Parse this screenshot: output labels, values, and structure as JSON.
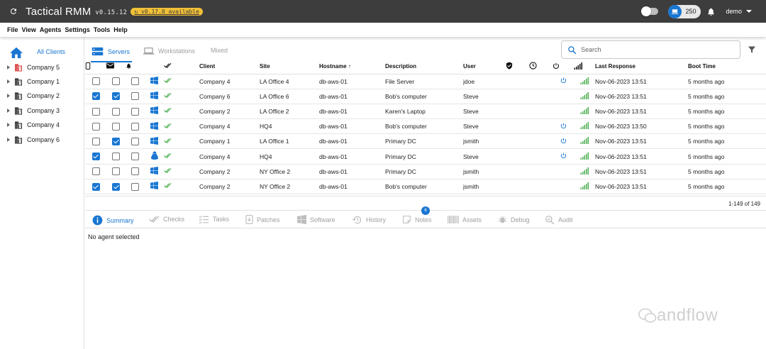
{
  "header": {
    "app_title": "Tactical RMM",
    "version": "v0.15.12",
    "update_badge": "v0.17.0 available",
    "agent_count": "250",
    "user": "demo"
  },
  "menu": [
    "File",
    "View",
    "Agents",
    "Settings",
    "Tools",
    "Help"
  ],
  "sidebar": {
    "all_clients": "All Clients",
    "clients": [
      "Company 5",
      "Company 1",
      "Company 2",
      "Company 3",
      "Company 4",
      "Company 6"
    ]
  },
  "tabs": {
    "servers": "Servers",
    "workstations": "Workstations",
    "mixed": "Mixed"
  },
  "search": {
    "placeholder": "Search"
  },
  "table": {
    "columns": {
      "client": "Client",
      "site": "Site",
      "hostname": "Hostname",
      "description": "Description",
      "user": "User",
      "last_response": "Last Response",
      "boot_time": "Boot Time"
    },
    "rows": [
      {
        "sel": false,
        "mail": false,
        "bell": false,
        "os": "windows",
        "client": "Company 4",
        "site": "LA Office 4",
        "hostname": "db-aws-01",
        "description": "File Server",
        "user": "jdoe",
        "reboot": true,
        "last": "Nov-06-2023 13:51",
        "boot": "5 months ago"
      },
      {
        "sel": true,
        "mail": true,
        "bell": false,
        "os": "windows",
        "client": "Company 6",
        "site": "LA Office 6",
        "hostname": "db-aws-01",
        "description": "Bob's computer",
        "user": "Steve",
        "reboot": false,
        "last": "Nov-06-2023 13:51",
        "boot": "5 months ago"
      },
      {
        "sel": false,
        "mail": false,
        "bell": false,
        "os": "windows",
        "client": "Company 2",
        "site": "LA Office 2",
        "hostname": "db-aws-01",
        "description": "Karen's Laptop",
        "user": "Steve",
        "reboot": false,
        "last": "Nov-06-2023 13:51",
        "boot": "5 months ago"
      },
      {
        "sel": false,
        "mail": false,
        "bell": false,
        "os": "windows",
        "client": "Company 4",
        "site": "HQ4",
        "hostname": "db-aws-01",
        "description": "Bob's computer",
        "user": "Steve",
        "reboot": true,
        "last": "Nov-06-2023 13:50",
        "boot": "5 months ago"
      },
      {
        "sel": false,
        "mail": true,
        "bell": false,
        "os": "windows",
        "client": "Company 1",
        "site": "LA Office 1",
        "hostname": "db-aws-01",
        "description": "Primary DC",
        "user": "jsmith",
        "reboot": true,
        "last": "Nov-06-2023 13:51",
        "boot": "5 months ago"
      },
      {
        "sel": true,
        "mail": false,
        "bell": false,
        "os": "linux",
        "client": "Company 4",
        "site": "HQ4",
        "hostname": "db-aws-01",
        "description": "Primary DC",
        "user": "Steve",
        "reboot": true,
        "last": "Nov-06-2023 13:51",
        "boot": "5 months ago"
      },
      {
        "sel": false,
        "mail": false,
        "bell": false,
        "os": "windows",
        "client": "Company 2",
        "site": "NY Office 2",
        "hostname": "db-aws-01",
        "description": "Primary DC",
        "user": "jsmith",
        "reboot": false,
        "last": "Nov-06-2023 13:51",
        "boot": "5 months ago"
      },
      {
        "sel": true,
        "mail": true,
        "bell": false,
        "os": "windows",
        "client": "Company 2",
        "site": "NY Office 2",
        "hostname": "db-aws-01",
        "description": "Bob's computer",
        "user": "jsmith",
        "reboot": false,
        "last": "Nov-06-2023 13:51",
        "boot": "5 months ago"
      }
    ],
    "pagination": "1-149 of 149"
  },
  "bottom_tabs": {
    "items": [
      "Summary",
      "Checks",
      "Tasks",
      "Patches",
      "Software",
      "History",
      "Notes",
      "Assets",
      "Debug",
      "Audit"
    ],
    "notes_badge": "6"
  },
  "no_agent": "No agent selected",
  "watermark": "andflow",
  "colors": {
    "header_bg": "#3d3d3d",
    "accent": "#1976d2",
    "update_badge": "#f2c037",
    "ok_green": "#4caf50",
    "client_red": "#d32f2f"
  }
}
